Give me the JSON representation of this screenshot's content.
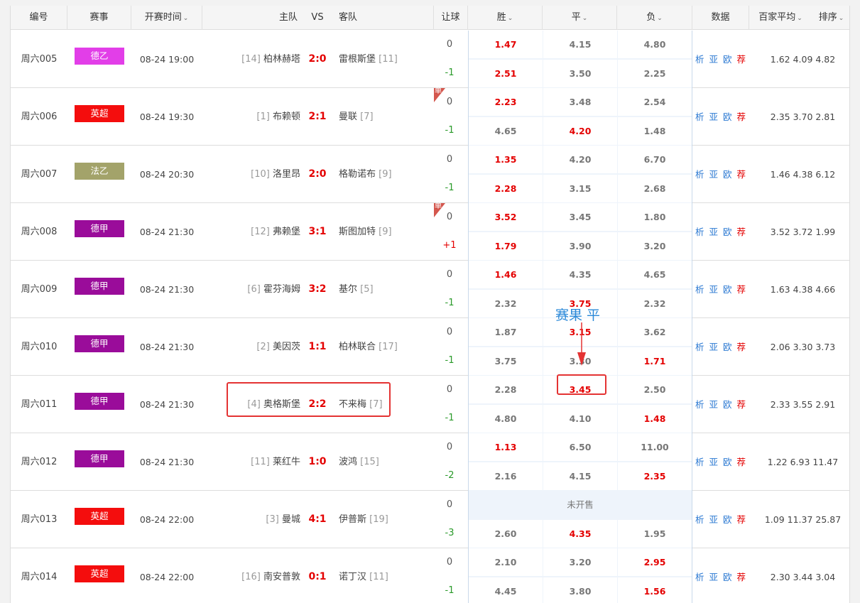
{
  "header": {
    "num": "编号",
    "league": "赛事",
    "time": "开赛时间",
    "home": "主队",
    "vs": "VS",
    "away": "客队",
    "handicap": "让球",
    "win": "胜",
    "draw": "平",
    "lose": "负",
    "data": "数据",
    "avg": "百家平均",
    "sort": "排序"
  },
  "links": {
    "analysis": "析",
    "asia": "亚",
    "euro": "欧",
    "recommend": "荐"
  },
  "unsold_label": "未开售",
  "dan_label": "单",
  "annotation": {
    "text": "赛果 平"
  },
  "colors": {
    "德乙": "#e23ee8",
    "英超": "#f40d0d",
    "法乙": "#a3a36a",
    "德甲": "#9a0c9a",
    "highlight_red": "#e40000",
    "link_blue": "#2a78d2"
  },
  "matches": [
    {
      "num": "周六005",
      "league": "德乙",
      "time": "08-24 19:00",
      "home_rank": "[14]",
      "home": "柏林赫塔",
      "score": "2:0",
      "away": "雷根斯堡",
      "away_rank": "[11]",
      "dan": false,
      "rows": [
        {
          "hcp": "0",
          "w": "1.47",
          "d": "4.15",
          "l": "4.80",
          "hl": [
            "w"
          ]
        },
        {
          "hcp": "-1",
          "w": "2.51",
          "d": "3.50",
          "l": "2.25",
          "hl": [
            "w"
          ]
        }
      ],
      "avg": "1.62  4.09  4.82"
    },
    {
      "num": "周六006",
      "league": "英超",
      "time": "08-24 19:30",
      "home_rank": "[1]",
      "home": "布赖顿",
      "score": "2:1",
      "away": "曼联",
      "away_rank": "[7]",
      "dan": true,
      "rows": [
        {
          "hcp": "0",
          "w": "2.23",
          "d": "3.48",
          "l": "2.54",
          "hl": [
            "w"
          ]
        },
        {
          "hcp": "-1",
          "w": "4.65",
          "d": "4.20",
          "l": "1.48",
          "hl": [
            "d"
          ]
        }
      ],
      "avg": "2.35  3.70  2.81"
    },
    {
      "num": "周六007",
      "league": "法乙",
      "time": "08-24 20:30",
      "home_rank": "[10]",
      "home": "洛里昂",
      "score": "2:0",
      "away": "格勒诺布",
      "away_rank": "[9]",
      "dan": false,
      "rows": [
        {
          "hcp": "0",
          "w": "1.35",
          "d": "4.20",
          "l": "6.70",
          "hl": [
            "w"
          ]
        },
        {
          "hcp": "-1",
          "w": "2.28",
          "d": "3.15",
          "l": "2.68",
          "hl": [
            "w"
          ]
        }
      ],
      "avg": "1.46  4.38  6.12"
    },
    {
      "num": "周六008",
      "league": "德甲",
      "time": "08-24 21:30",
      "home_rank": "[12]",
      "home": "弗赖堡",
      "score": "3:1",
      "away": "斯图加特",
      "away_rank": "[9]",
      "dan": true,
      "rows": [
        {
          "hcp": "0",
          "w": "3.52",
          "d": "3.45",
          "l": "1.80",
          "hl": [
            "w"
          ]
        },
        {
          "hcp": "+1",
          "w": "1.79",
          "d": "3.90",
          "l": "3.20",
          "hl": [
            "w"
          ]
        }
      ],
      "avg": "3.52  3.72  1.99"
    },
    {
      "num": "周六009",
      "league": "德甲",
      "time": "08-24 21:30",
      "home_rank": "[6]",
      "home": "霍芬海姆",
      "score": "3:2",
      "away": "基尔",
      "away_rank": "[5]",
      "dan": false,
      "rows": [
        {
          "hcp": "0",
          "w": "1.46",
          "d": "4.35",
          "l": "4.65",
          "hl": [
            "w"
          ]
        },
        {
          "hcp": "-1",
          "w": "2.32",
          "d": "3.75",
          "l": "2.32",
          "hl": [
            "d"
          ]
        }
      ],
      "avg": "1.63  4.38  4.66"
    },
    {
      "num": "周六010",
      "league": "德甲",
      "time": "08-24 21:30",
      "home_rank": "[2]",
      "home": "美因茨",
      "score": "1:1",
      "away": "柏林联合",
      "away_rank": "[17]",
      "dan": false,
      "rows": [
        {
          "hcp": "0",
          "w": "1.87",
          "d": "3.15",
          "l": "3.62",
          "hl": [
            "d"
          ]
        },
        {
          "hcp": "-1",
          "w": "3.75",
          "d": "3.30",
          "l": "1.71",
          "hl": [
            "l"
          ]
        }
      ],
      "avg": "2.06  3.30  3.73"
    },
    {
      "num": "周六011",
      "league": "德甲",
      "time": "08-24 21:30",
      "home_rank": "[4]",
      "home": "奥格斯堡",
      "score": "2:2",
      "away": "不来梅",
      "away_rank": "[7]",
      "dan": false,
      "rows": [
        {
          "hcp": "0",
          "w": "2.28",
          "d": "3.45",
          "l": "2.50",
          "hl": [
            "d"
          ]
        },
        {
          "hcp": "-1",
          "w": "4.80",
          "d": "4.10",
          "l": "1.48",
          "hl": [
            "l"
          ]
        }
      ],
      "avg": "2.33  3.55  2.91"
    },
    {
      "num": "周六012",
      "league": "德甲",
      "time": "08-24 21:30",
      "home_rank": "[11]",
      "home": "莱红牛",
      "score": "1:0",
      "away": "波鸿",
      "away_rank": "[15]",
      "dan": false,
      "rows": [
        {
          "hcp": "0",
          "w": "1.13",
          "d": "6.50",
          "l": "11.00",
          "hl": [
            "w"
          ]
        },
        {
          "hcp": "-2",
          "w": "2.16",
          "d": "4.15",
          "l": "2.35",
          "hl": [
            "l"
          ]
        }
      ],
      "avg": "1.22  6.93  11.47"
    },
    {
      "num": "周六013",
      "league": "英超",
      "time": "08-24 22:00",
      "home_rank": "[3]",
      "home": "曼城",
      "score": "4:1",
      "away": "伊普斯",
      "away_rank": "[19]",
      "dan": false,
      "rows": [
        {
          "hcp": "0",
          "unsold": true,
          "hl": []
        },
        {
          "hcp": "-3",
          "w": "2.60",
          "d": "4.35",
          "l": "1.95",
          "hl": [
            "d"
          ]
        }
      ],
      "avg": "1.09  11.37  25.87"
    },
    {
      "num": "周六014",
      "league": "英超",
      "time": "08-24 22:00",
      "home_rank": "[16]",
      "home": "南安普敦",
      "score": "0:1",
      "away": "诺丁汉",
      "away_rank": "[11]",
      "dan": false,
      "rows": [
        {
          "hcp": "0",
          "w": "2.10",
          "d": "3.20",
          "l": "2.95",
          "hl": [
            "l"
          ]
        },
        {
          "hcp": "-1",
          "w": "4.45",
          "d": "3.80",
          "l": "1.56",
          "hl": [
            "l"
          ]
        }
      ],
      "avg": "2.30  3.44  3.04"
    }
  ]
}
